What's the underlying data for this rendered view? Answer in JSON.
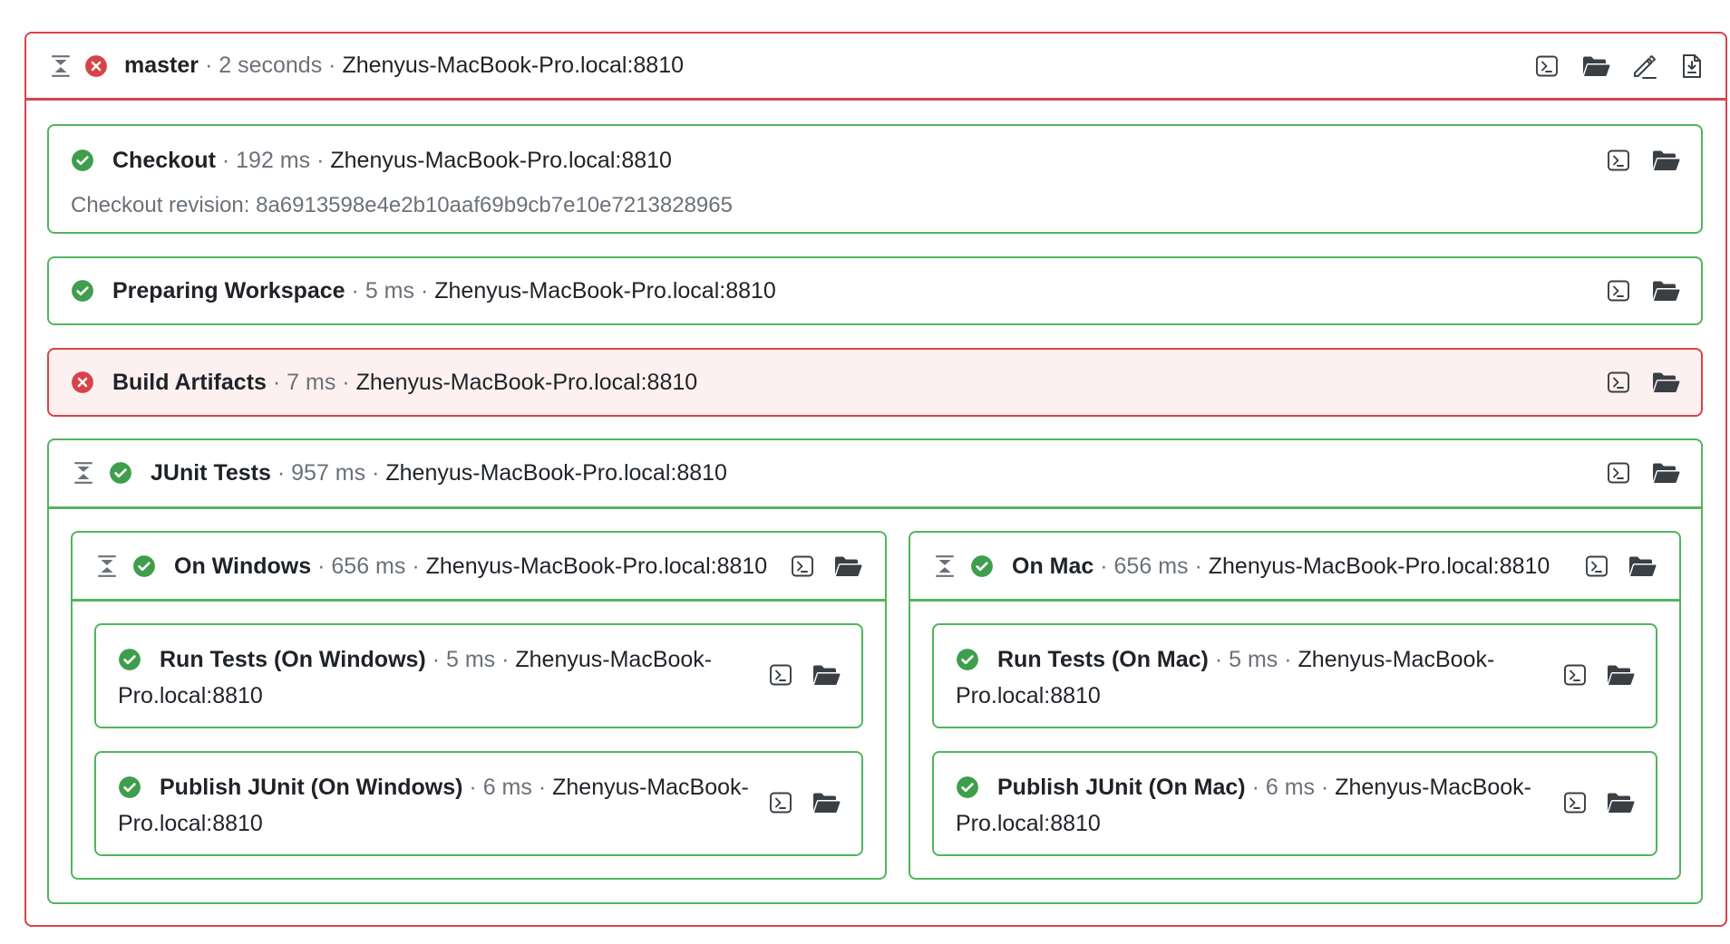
{
  "root": {
    "name": "master",
    "duration": "2 seconds",
    "host": "Zhenyus-MacBook-Pro.local:8810",
    "status": "failed"
  },
  "steps": {
    "checkout": {
      "name": "Checkout",
      "duration": "192 ms",
      "host": "Zhenyus-MacBook-Pro.local:8810",
      "detail": "Checkout revision: 8a6913598e4e2b10aaf69b9cb7e10e7213828965"
    },
    "prepare": {
      "name": "Preparing Workspace",
      "duration": "5 ms",
      "host": "Zhenyus-MacBook-Pro.local:8810"
    },
    "build": {
      "name": "Build Artifacts",
      "duration": "7 ms",
      "host": "Zhenyus-MacBook-Pro.local:8810"
    },
    "junit": {
      "name": "JUnit Tests",
      "duration": "957 ms",
      "host": "Zhenyus-MacBook-Pro.local:8810"
    },
    "windows": {
      "name": "On Windows",
      "duration": "656 ms",
      "host": "Zhenyus-MacBook-Pro.local:8810",
      "run": {
        "name": "Run Tests (On Windows)",
        "duration": "5 ms",
        "host_a": "Zhenyus-MacBook-",
        "host_b": "Pro.local:8810"
      },
      "publish": {
        "name": "Publish JUnit (On Windows)",
        "duration": "6 ms",
        "host_a": "Zhenyus-MacBook-",
        "host_b": "Pro.local:8810"
      }
    },
    "mac": {
      "name": "On Mac",
      "duration": "656 ms",
      "host": "Zhenyus-MacBook-Pro.local:8810",
      "run": {
        "name": "Run Tests (On Mac)",
        "duration": "5 ms",
        "host_a": "Zhenyus-MacBook-",
        "host_b": "Pro.local:8810"
      },
      "publish": {
        "name": "Publish JUnit (On Mac)",
        "duration": "6 ms",
        "host_a": "Zhenyus-MacBook-",
        "host_b": "Pro.local:8810"
      }
    }
  },
  "icons": {
    "success": "check-circle-icon",
    "failure": "x-circle-icon",
    "collapse": "collapse-icon",
    "log": "terminal-log-icon",
    "folder": "folder-open-icon",
    "edit": "edit-icon",
    "download": "download-log-icon"
  },
  "colors": {
    "success": "#3f9e4c",
    "success_border": "#52b45f",
    "failure": "#d8434a",
    "failure_bg": "#fdf0f0",
    "muted": "#6b7178"
  }
}
